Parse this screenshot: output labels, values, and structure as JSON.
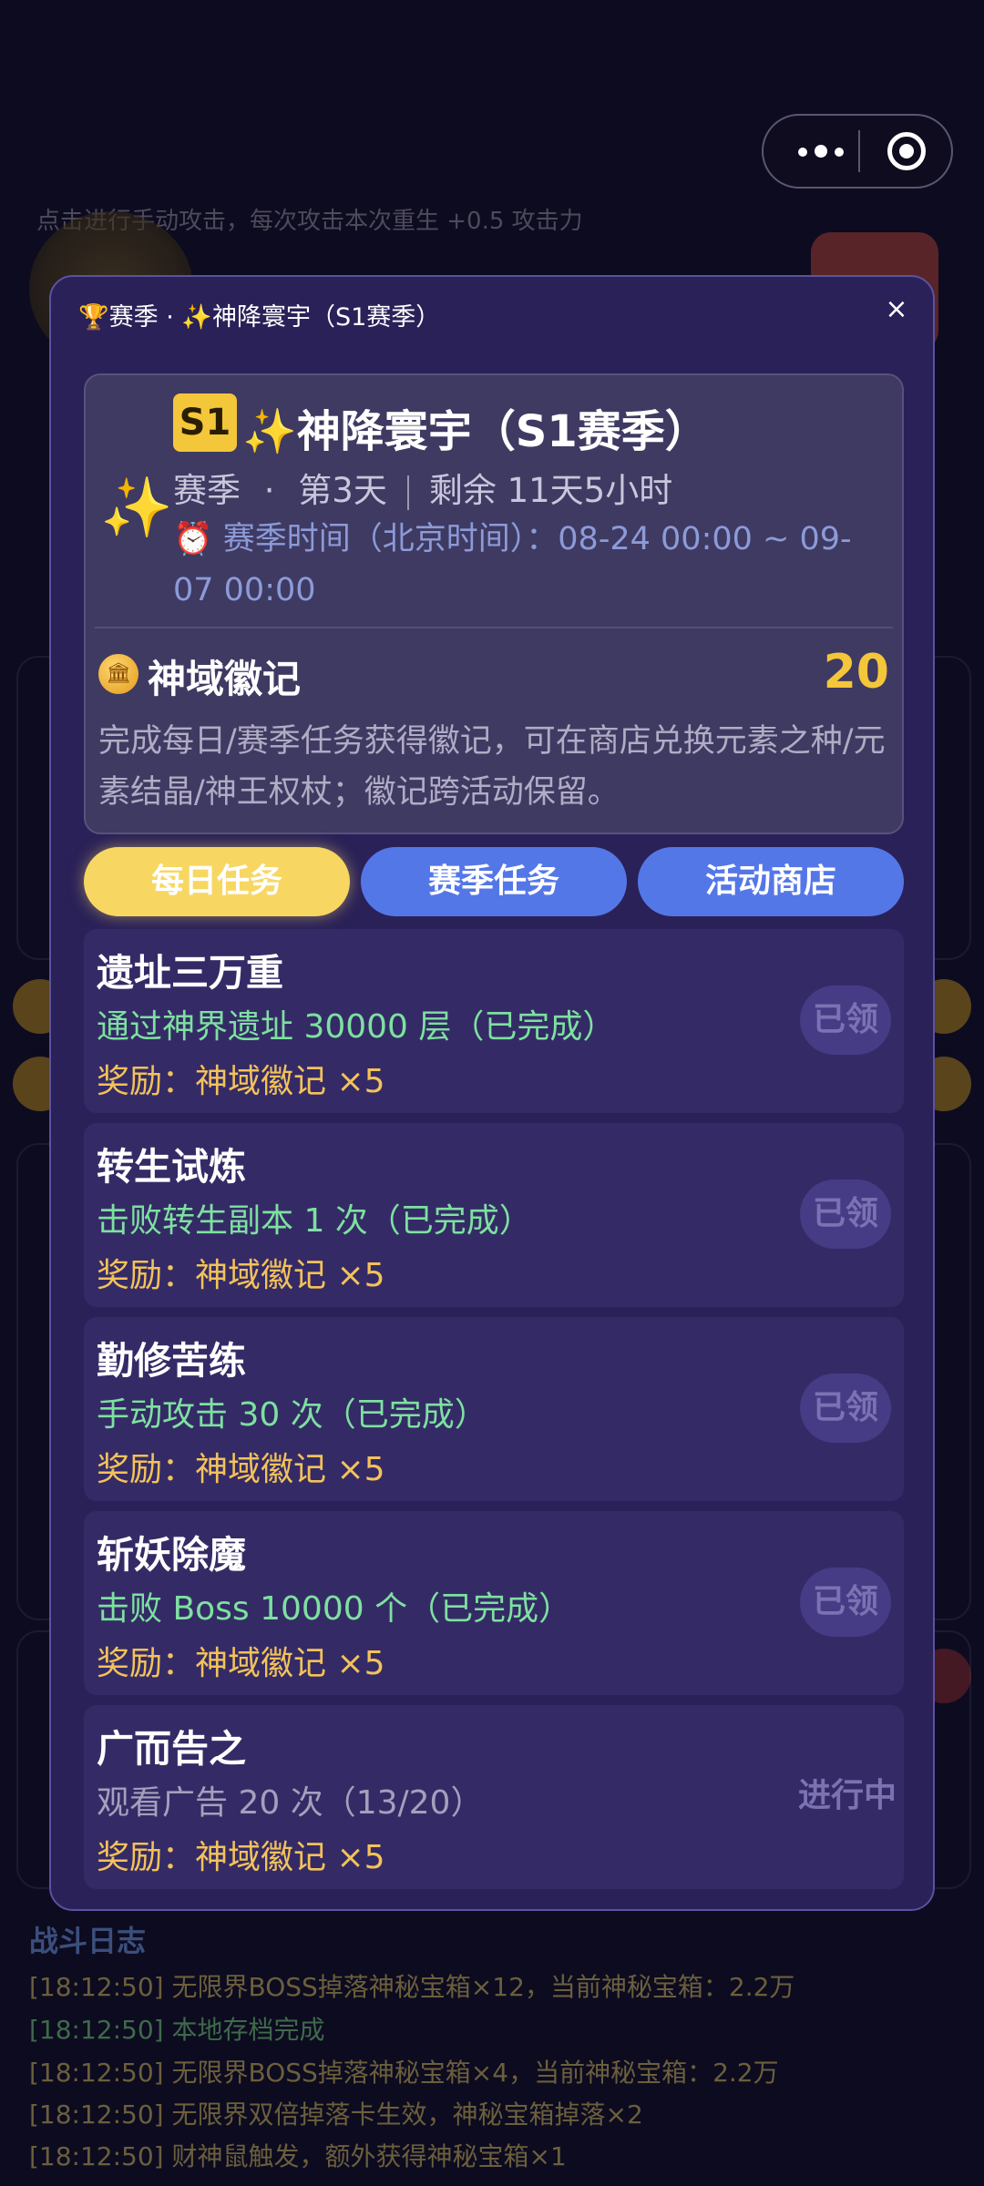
{
  "capsule": {
    "more_icon": "more-dots-icon",
    "close_icon": "target-circle-icon"
  },
  "background": {
    "hint": "点击进行手动攻击，每次攻击本次重生 +0.5 攻击力",
    "log": {
      "title": "战斗日志",
      "lines": [
        "[18:12:50] 无限界BOSS掉落神秘宝箱×12，当前神秘宝箱：2.2万",
        "[18:12:50] 本地存档完成",
        "[18:12:50] 无限界BOSS掉落神秘宝箱×4，当前神秘宝箱：2.2万",
        "[18:12:50] 无限界双倍掉落卡生效，神秘宝箱掉落×2",
        "[18:12:50] 财神鼠触发，额外获得神秘宝箱×1"
      ]
    }
  },
  "modal": {
    "title": "🏆赛季 · ✨神降寰宇（S1赛季）",
    "close": "×",
    "season": {
      "badge": "S1",
      "sparkle": "✨",
      "name": "神降寰宇（S1赛季）",
      "type": "赛季",
      "dot": "·",
      "day": "第3天",
      "remaining": "剩余 11天5小时",
      "time": "⏰ 赛季时间（北京时间）：08-24 00:00 ~ 09-07 00:00"
    },
    "currency": {
      "icon": "🏛",
      "label": "神域徽记",
      "value": "20",
      "desc": "完成每日/赛季任务获得徽记，可在商店兑换元素之种/元素结晶/神王权杖；徽记跨活动保留。"
    },
    "tabs": [
      "每日任务",
      "赛季任务",
      "活动商店"
    ],
    "active_tab": "每日任务",
    "tasks": [
      {
        "name": "遗址三万重",
        "desc": "通过神界遗址 30000 层（已完成）",
        "reward": "奖励：神域徽记 ×5",
        "status": "已领"
      },
      {
        "name": "转生试炼",
        "desc": "击败转生副本 1 次（已完成）",
        "reward": "奖励：神域徽记 ×5",
        "status": "已领"
      },
      {
        "name": "勤修苦练",
        "desc": "手动攻击 30 次（已完成）",
        "reward": "奖励：神域徽记 ×5",
        "status": "已领"
      },
      {
        "name": "斩妖除魔",
        "desc": "击败 Boss 10000 个（已完成）",
        "reward": "奖励：神域徽记 ×5",
        "status": "已领"
      },
      {
        "name": "广而告之",
        "desc": "观看广告 20 次（13/20）",
        "reward": "奖励：神域徽记 ×5",
        "status": "进行中"
      }
    ]
  }
}
